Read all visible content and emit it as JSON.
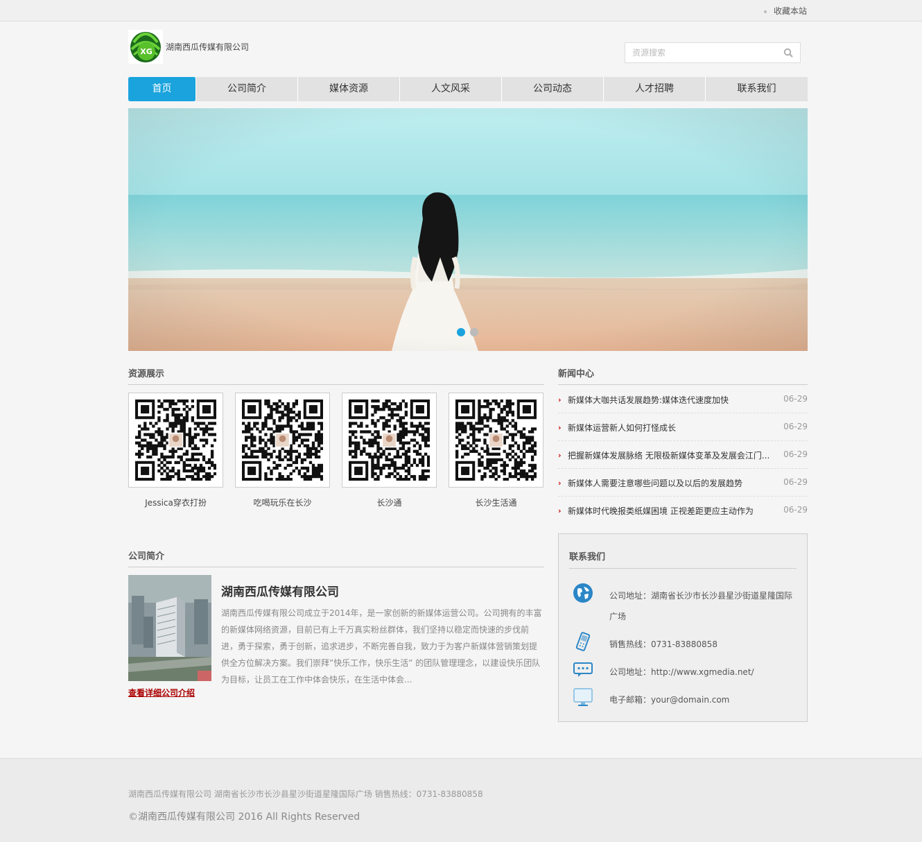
{
  "topbar": {
    "favorite_label": "收藏本站"
  },
  "header": {
    "company_name": "湖南西瓜传媒有限公司",
    "logo_text": "XG"
  },
  "search": {
    "placeholder": "资源搜索"
  },
  "nav": {
    "items": [
      {
        "label": "首页",
        "active": true
      },
      {
        "label": "公司简介",
        "active": false
      },
      {
        "label": "媒体资源",
        "active": false
      },
      {
        "label": "人文风采",
        "active": false
      },
      {
        "label": "公司动态",
        "active": false
      },
      {
        "label": "人才招聘",
        "active": false
      },
      {
        "label": "联系我们",
        "active": false
      }
    ]
  },
  "banner": {
    "slide_count": 2,
    "current_slide": 1
  },
  "resources": {
    "title": "资源展示",
    "items": [
      {
        "label": "Jessica穿衣打扮"
      },
      {
        "label": "吃喝玩乐在长沙"
      },
      {
        "label": "长沙通"
      },
      {
        "label": "长沙生活通"
      }
    ]
  },
  "news": {
    "title": "新闻中心",
    "items": [
      {
        "title": "新媒体大咖共话发展趋势:媒体迭代速度加快",
        "date": "06-29"
      },
      {
        "title": "新媒体运营新人如何打怪成长",
        "date": "06-29"
      },
      {
        "title": "把握新媒体发展脉络 无限极新媒体变革及发展会江门...",
        "date": "06-29"
      },
      {
        "title": "新媒体人需要注意哪些问题以及以后的发展趋势",
        "date": "06-29"
      },
      {
        "title": "新媒体时代晚报类纸媒困境 正视差距更应主动作为",
        "date": "06-29"
      }
    ]
  },
  "about": {
    "title": "公司简介",
    "heading": "湖南西瓜传媒有限公司",
    "text": "湖南西瓜传媒有限公司成立于2014年，是一家创新的新媒体运营公司。公司拥有的丰富的新媒体网络资源，目前已有上千万真实粉丝群体，我们坚持以稳定而快速的步伐前进，勇于探索，勇于创新，追求进步，不断完善自我，致力于为客户新媒体营销策划提供全方位解决方案。我们崇拜”快乐工作，快乐生活” 的团队管理理念，以建设快乐团队为目标，让员工在工作中体会快乐，在生活中体会...",
    "link": "查看详细公司介绍"
  },
  "contact": {
    "title": "联系我们",
    "items": [
      {
        "icon": "globe-icon",
        "text": "公司地址：湖南省长沙市长沙县星沙街道星隆国际广场"
      },
      {
        "icon": "phone-icon",
        "text": "销售热线：0731-83880858"
      },
      {
        "icon": "chat-icon",
        "text": "公司地址：http://www.xgmedia.net/"
      },
      {
        "icon": "monitor-icon",
        "text": "电子邮箱：your@domain.com"
      }
    ]
  },
  "footer": {
    "line1": "湖南西瓜传媒有限公司 湖南省长沙市长沙县星沙街道星隆国际广场 销售热线：0731-83880858",
    "line2": "©湖南西瓜传媒有限公司 2016 All Rights Reserved"
  },
  "colors": {
    "accent": "#1aa3dd",
    "link_red": "#aa0000",
    "arrow_red": "#cc0000"
  }
}
